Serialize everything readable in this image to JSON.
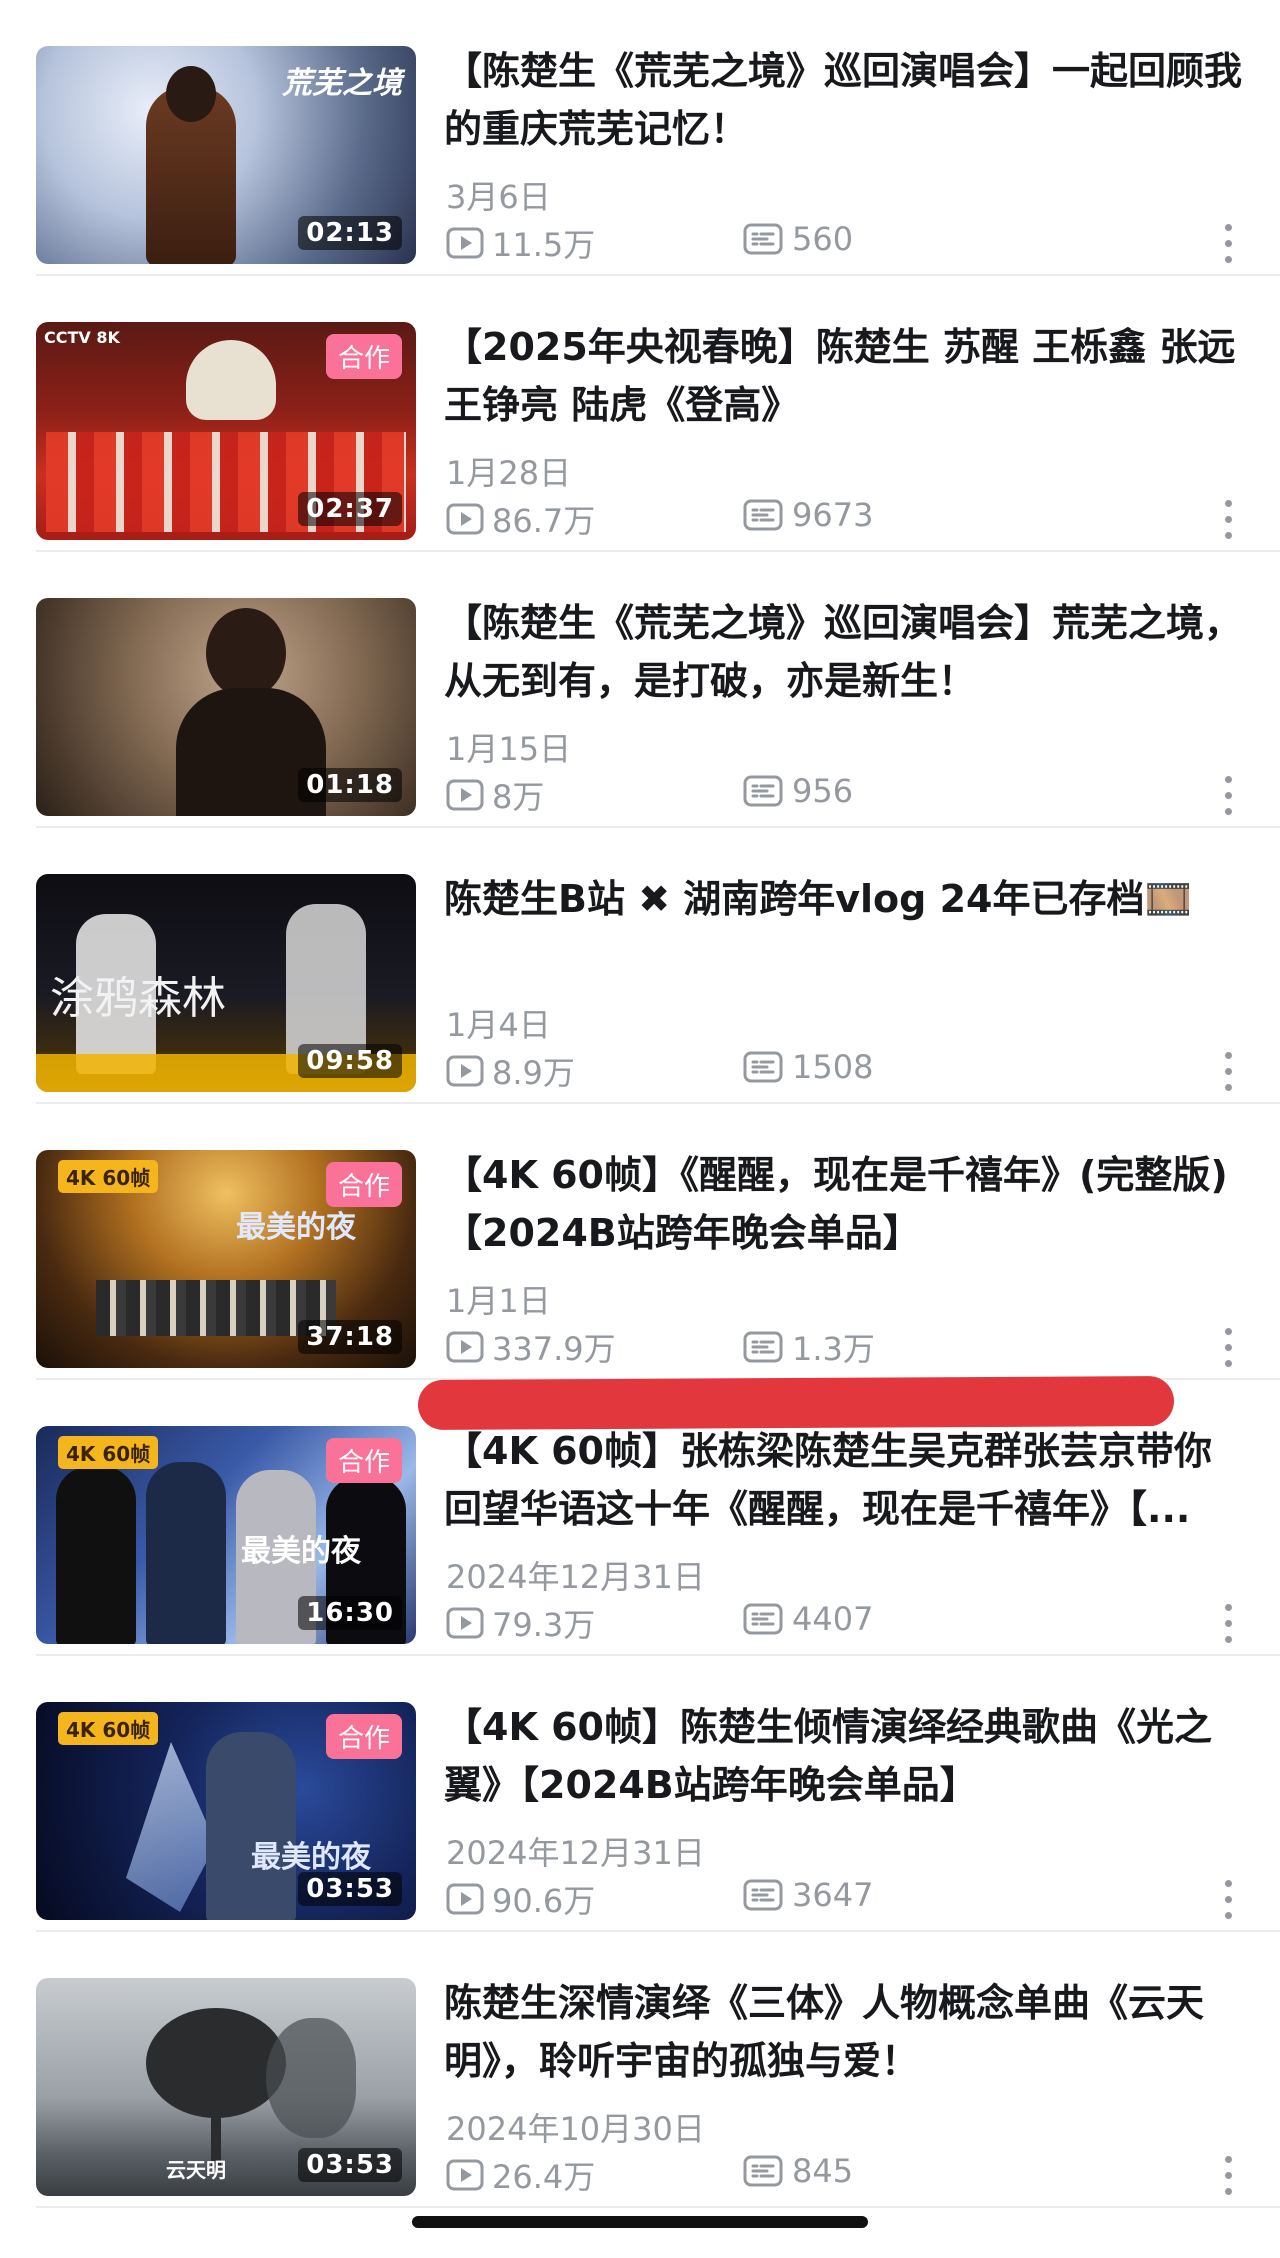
{
  "videos": [
    {
      "title": "【陈楚生《荒芜之境》巡回演唱会】一起回顾我的重庆荒芜记忆！",
      "date": "3月6日",
      "plays": "11.5万",
      "danmaku": "560",
      "duration": "02:13",
      "badge": "",
      "quality": "",
      "thumb_text": "荒芜之境"
    },
    {
      "title": "【2025年央视春晚】陈楚生 苏醒 王栎鑫 张远 王铮亮 陆虎《登高》",
      "date": "1月28日",
      "plays": "86.7万",
      "danmaku": "9673",
      "duration": "02:37",
      "badge": "合作",
      "quality": "",
      "thumb_text": "CCTV 8K"
    },
    {
      "title": "【陈楚生《荒芜之境》巡回演唱会】荒芜之境，从无到有，是打破，亦是新生！",
      "date": "1月15日",
      "plays": "8万",
      "danmaku": "956",
      "duration": "01:18",
      "badge": "",
      "quality": "",
      "thumb_text": ""
    },
    {
      "title": "陈楚生B站 ✖ 湖南跨年vlog 24年已存档🎞️",
      "date": "1月4日",
      "plays": "8.9万",
      "danmaku": "1508",
      "duration": "09:58",
      "badge": "",
      "quality": "",
      "thumb_text": "涂鸦森林"
    },
    {
      "title": "【4K 60帧】《醒醒，现在是千禧年》(完整版)【2024B站跨年晚会单品】",
      "date": "1月1日",
      "plays": "337.9万",
      "danmaku": "1.3万",
      "duration": "37:18",
      "badge": "合作",
      "quality": "4K 60帧",
      "thumb_text": "最美的夜"
    },
    {
      "title": "【4K 60帧】张栋梁陈楚生吴克群张芸京带你回望华语这十年《醒醒，现在是千禧年》【...",
      "date": "2024年12月31日",
      "plays": "79.3万",
      "danmaku": "4407",
      "duration": "16:30",
      "badge": "合作",
      "quality": "4K 60帧",
      "thumb_text": "最美的夜"
    },
    {
      "title": "【4K 60帧】陈楚生倾情演绎经典歌曲《光之翼》【2024B站跨年晚会单品】",
      "date": "2024年12月31日",
      "plays": "90.6万",
      "danmaku": "3647",
      "duration": "03:53",
      "badge": "合作",
      "quality": "4K 60帧",
      "thumb_text": "最美的夜"
    },
    {
      "title": "陈楚生深情演绎《三体》人物概念单曲《云天明》，聆听宇宙的孤独与爱！",
      "date": "2024年10月30日",
      "plays": "26.4万",
      "danmaku": "845",
      "duration": "03:53",
      "badge": "",
      "quality": "",
      "thumb_text": "云天明"
    }
  ],
  "icons": {
    "play": "play-count-icon",
    "danmaku": "danmaku-icon",
    "more": "more-vertical-icon"
  },
  "colors": {
    "badge": "#fb7299",
    "meta": "#9499a0",
    "title": "#18191c",
    "annotation": "#e2373d"
  }
}
